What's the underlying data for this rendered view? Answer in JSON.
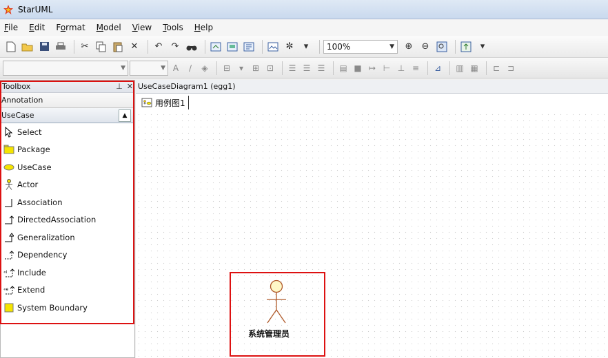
{
  "window": {
    "title": "StarUML"
  },
  "menu": {
    "items": [
      {
        "label": "File",
        "key": "F",
        "rest": "ile"
      },
      {
        "label": "Edit",
        "key": "E",
        "rest": "dit"
      },
      {
        "label": "Format",
        "key": "o",
        "pre": "F",
        "rest": "rmat"
      },
      {
        "label": "Model",
        "key": "M",
        "rest": "odel"
      },
      {
        "label": "View",
        "key": "V",
        "rest": "iew"
      },
      {
        "label": "Tools",
        "key": "T",
        "rest": "ools"
      },
      {
        "label": "Help",
        "key": "H",
        "rest": "elp"
      }
    ]
  },
  "toolbar": {
    "zoom_value": "100%"
  },
  "toolbox": {
    "title": "Toolbox",
    "pin_glyph": "⊥",
    "close_glyph": "✕",
    "annotation_label": "Annotation",
    "usecase_label": "UseCase",
    "items": [
      {
        "label": "Select",
        "icon": "pointer-icon"
      },
      {
        "label": "Package",
        "icon": "package-icon"
      },
      {
        "label": "UseCase",
        "icon": "usecase-icon"
      },
      {
        "label": "Actor",
        "icon": "actor-icon"
      },
      {
        "label": "Association",
        "icon": "association-icon"
      },
      {
        "label": "DirectedAssociation",
        "icon": "directed-association-icon"
      },
      {
        "label": "Generalization",
        "icon": "generalization-icon"
      },
      {
        "label": "Dependency",
        "icon": "dependency-icon"
      },
      {
        "label": "Include",
        "icon": "include-icon"
      },
      {
        "label": "Extend",
        "icon": "extend-icon"
      },
      {
        "label": "System Boundary",
        "icon": "system-boundary-icon"
      }
    ]
  },
  "editor": {
    "header": "UseCaseDiagram1 (egg1)",
    "tab_label": "用例图1",
    "actor_name": "系统管理员"
  },
  "colors": {
    "highlight": "#dd1111",
    "package_yellow": "#f5e400",
    "actor_fill": "#fff8c8"
  }
}
